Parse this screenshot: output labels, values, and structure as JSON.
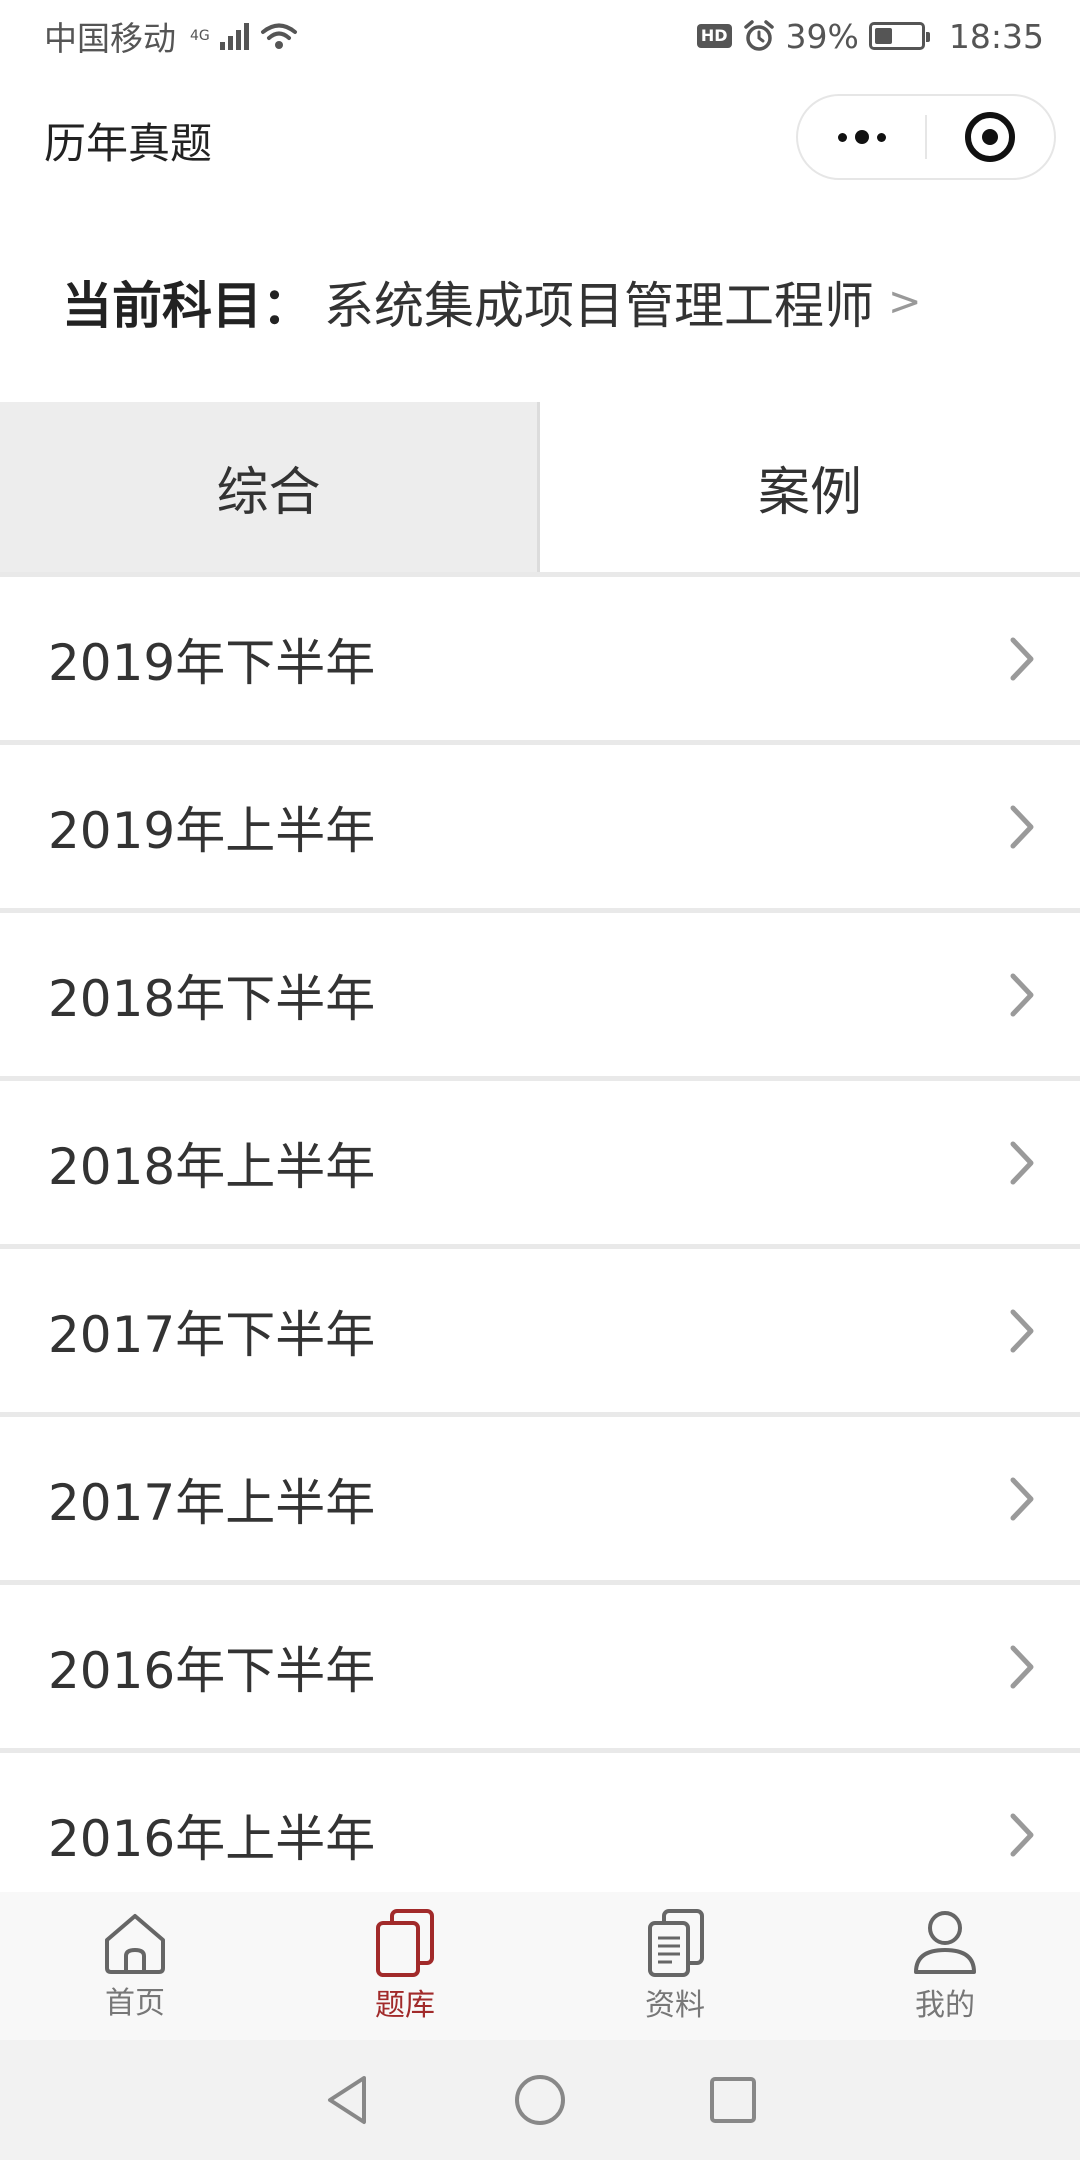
{
  "status_bar": {
    "carrier": "中国移动",
    "network": "4G",
    "hd_badge": "HD",
    "battery_percent_text": "39%",
    "battery_level": 0.39,
    "time": "18:35"
  },
  "header": {
    "title": "历年真题"
  },
  "subject": {
    "label": "当前科目：",
    "value": "系统集成项目管理工程师",
    "arrow": ">"
  },
  "tabs": [
    {
      "label": "综合",
      "active": true
    },
    {
      "label": "案例",
      "active": false
    }
  ],
  "exam_list": [
    {
      "label": "2019年下半年"
    },
    {
      "label": "2019年上半年"
    },
    {
      "label": "2018年下半年"
    },
    {
      "label": "2018年上半年"
    },
    {
      "label": "2017年下半年"
    },
    {
      "label": "2017年上半年"
    },
    {
      "label": "2016年下半年"
    },
    {
      "label": "2016年上半年"
    }
  ],
  "tabbar": {
    "items": [
      {
        "label": "首页",
        "icon": "home-icon",
        "active": false
      },
      {
        "label": "题库",
        "icon": "question-bank-icon",
        "active": true
      },
      {
        "label": "资料",
        "icon": "documents-icon",
        "active": false
      },
      {
        "label": "我的",
        "icon": "user-icon",
        "active": false
      }
    ]
  },
  "colors": {
    "accent": "#a12a2a",
    "tab_active_bg": "#ededed",
    "divider": "#e9e9e9"
  }
}
